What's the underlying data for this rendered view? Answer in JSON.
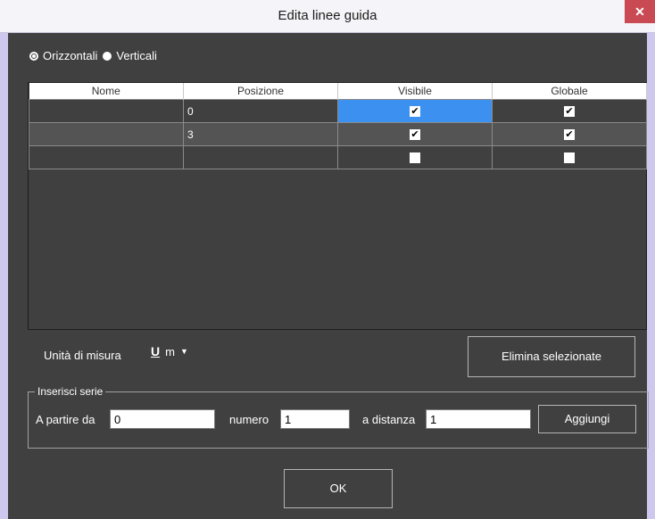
{
  "window": {
    "title": "Edita linee guida",
    "close_glyph": "✕"
  },
  "orientation": {
    "options": [
      {
        "label": "Orizzontali",
        "selected": true
      },
      {
        "label": "Verticali",
        "selected": false
      }
    ]
  },
  "table": {
    "columns": [
      "Nome",
      "Posizione",
      "Visibile",
      "Globale"
    ],
    "rows": [
      {
        "nome": "",
        "posizione": "0",
        "visibile": true,
        "globale": true
      },
      {
        "nome": "",
        "posizione": "3",
        "visibile": true,
        "globale": true
      },
      {
        "nome": "",
        "posizione": "",
        "visibile": false,
        "globale": false
      }
    ]
  },
  "units": {
    "label": "Unità di misura",
    "unit_glyph": "U",
    "unit_value": "m"
  },
  "buttons": {
    "delete_selected": "Elimina selezionate",
    "add": "Aggiungi",
    "ok": "OK"
  },
  "series": {
    "title": "Inserisci serie",
    "start_label": "A partire da",
    "start_value": "0",
    "count_label": "numero",
    "count_value": "1",
    "distance_label": "a distanza",
    "distance_value": "1"
  }
}
